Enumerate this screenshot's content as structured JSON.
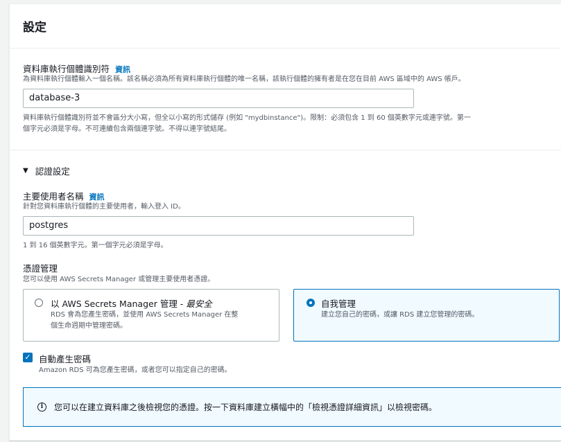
{
  "panel": {
    "title": "設定"
  },
  "db_identifier": {
    "label": "資料庫執行個體識別符",
    "info": "資訊",
    "description": "為資料庫執行個體輸入一個名稱。該名稱必須為所有資料庫執行個體的唯一名稱，該執行個體的擁有者是在您在目前 AWS 區域中的 AWS 帳戶。",
    "value": "database-3",
    "constraint_line1": "資料庫執行個體識別符並不會區分大小寫，但全以小寫的形式儲存 (例如 \"mydbinstance\")。限制：必須包含 1 到 60 個英數字元或連字號。第一",
    "constraint_line2": "個字元必須是字母。不可連續包含兩個連字號。不得以連字號結尾。"
  },
  "credentials": {
    "section_title": "認證設定",
    "master_user": {
      "label": "主要使用者名稱",
      "info": "資訊",
      "description": "針對您資料庫執行個體的主要使用者，輸入登入 ID。",
      "value": "postgres",
      "constraint": "1 到 16 個英數字元。第一個字元必須是字母。"
    },
    "management": {
      "label": "憑證管理",
      "description": "您可以使用 AWS Secrets Manager 或管理主要使用者憑證。",
      "options": [
        {
          "title_main": "以 AWS Secrets Manager 管理 - ",
          "title_emphasis": "最安全",
          "desc_line1": "RDS 會為您產生密碼，並使用 AWS Secrets Manager 在整",
          "desc_line2": "個生命週期中管理密碼。",
          "selected": false
        },
        {
          "title_main": "自我管理",
          "desc_line1": "建立您自己的密碼，或讓 RDS 建立您管理的密碼。",
          "selected": true
        }
      ]
    },
    "auto_password": {
      "label": "自動產生密碼",
      "description": "Amazon RDS 可為您產生密碼，或者您可以指定自己的密碼。",
      "checked": true
    },
    "alert": {
      "text": "您可以在建立資料庫之後檢視您的憑證。按一下資料庫建立橫幅中的「檢視憑證詳細資訊」以檢視密碼。"
    }
  },
  "colors": {
    "accent": "#0073bb",
    "border": "#aab7b8",
    "muted_text": "#545b64"
  }
}
